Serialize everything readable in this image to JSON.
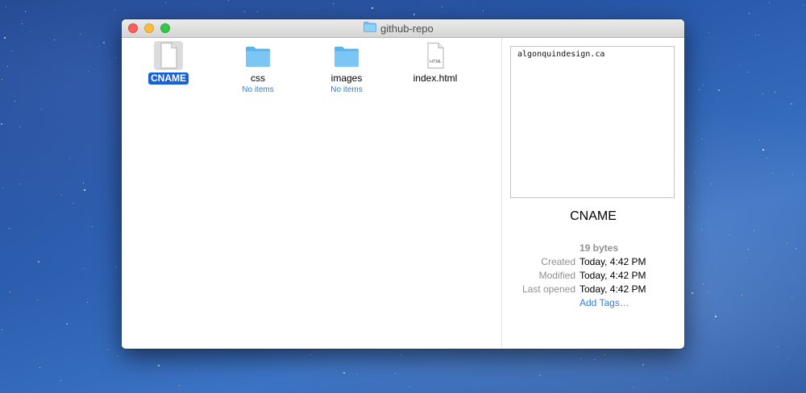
{
  "window": {
    "title": "github-repo"
  },
  "files": [
    {
      "name": "CNAME",
      "sub": "",
      "kind": "document-icon",
      "selected": true
    },
    {
      "name": "css",
      "sub": "No items",
      "kind": "folder-icon",
      "selected": false
    },
    {
      "name": "images",
      "sub": "No items",
      "kind": "folder-icon",
      "selected": false
    },
    {
      "name": "index.html",
      "sub": "",
      "kind": "html-file-icon",
      "selected": false
    }
  ],
  "preview": {
    "content": "algonquindesign.ca",
    "filename": "CNAME",
    "size": "19 bytes",
    "created_label": "Created",
    "created_value": "Today, 4:42 PM",
    "modified_label": "Modified",
    "modified_value": "Today, 4:42 PM",
    "opened_label": "Last opened",
    "opened_value": "Today, 4:42 PM",
    "add_tags": "Add Tags…"
  },
  "html_badge": "HTML",
  "colors": {
    "selection": "#1862d6",
    "link": "#2f7ddc",
    "folder": "#62b8f0"
  }
}
